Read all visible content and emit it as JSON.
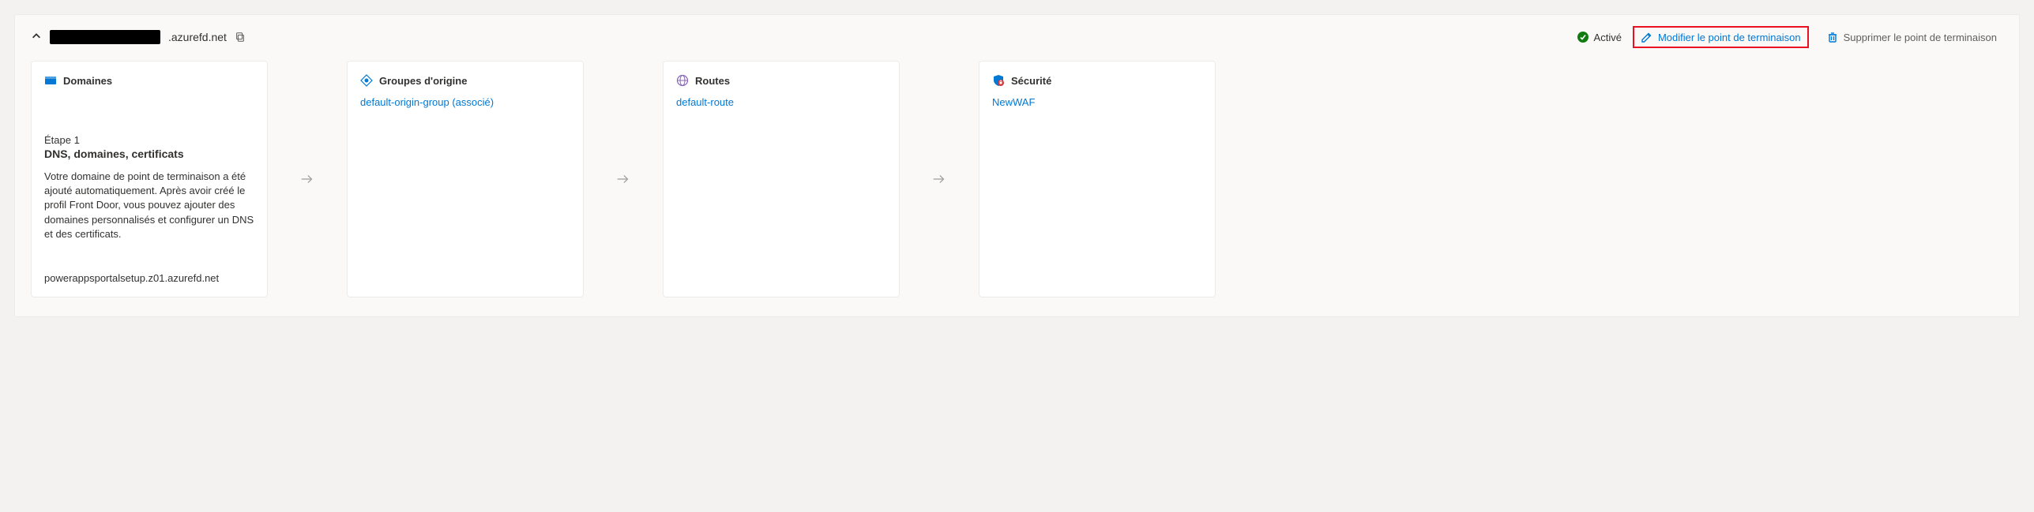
{
  "header": {
    "endpoint_suffix": ".azurefd.net",
    "status_label": "Activé",
    "edit_label": "Modifier le point de terminaison",
    "delete_label": "Supprimer le point de terminaison"
  },
  "cards": {
    "domains": {
      "title": "Domaines",
      "step_label": "Étape 1",
      "step_title": "DNS, domaines, certificats",
      "description": "Votre domaine de point de terminaison a été ajouté automatiquement. Après avoir créé le profil Front Door, vous pouvez ajouter des domaines personnalisés et configurer un DNS et des certificats.",
      "footer": "powerappsportalsetup.z01.azurefd.net"
    },
    "origin_groups": {
      "title": "Groupes d'origine",
      "items": [
        "default-origin-group (associé)"
      ]
    },
    "routes": {
      "title": "Routes",
      "items": [
        "default-route"
      ]
    },
    "security": {
      "title": "Sécurité",
      "items": [
        "NewWAF"
      ]
    }
  }
}
